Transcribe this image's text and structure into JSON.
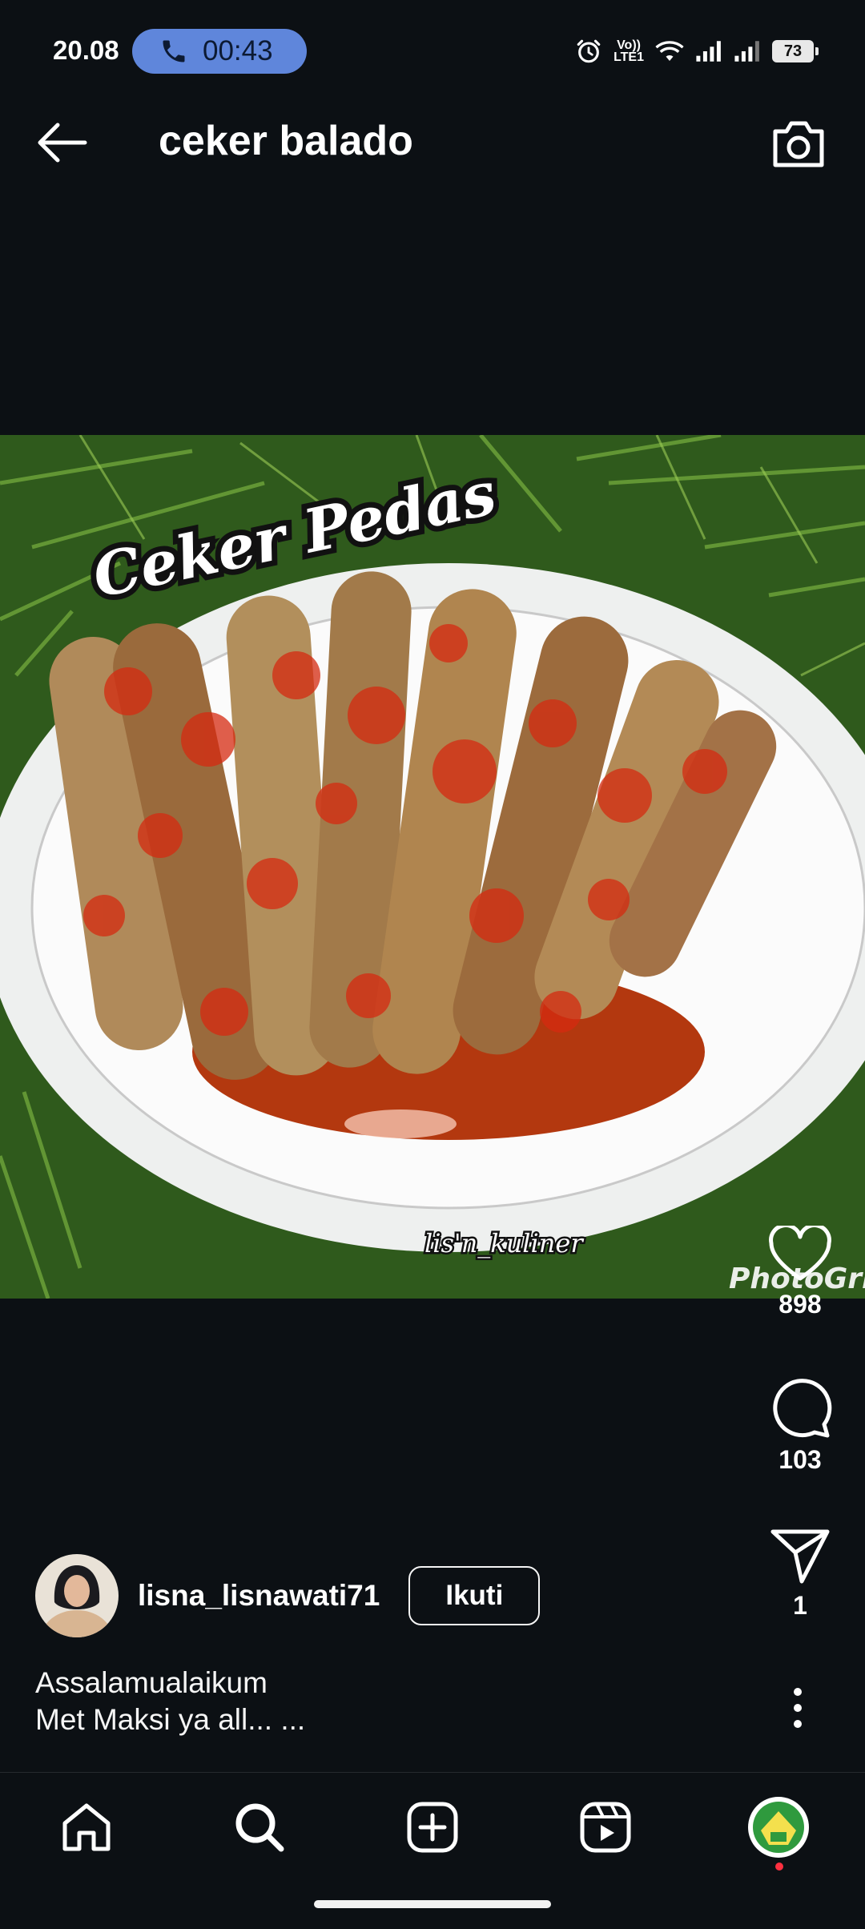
{
  "status_bar": {
    "time": "20.08",
    "call_timer": "00:43",
    "network_label_top": "Vo))",
    "network_label_bottom": "LTE1",
    "battery": "73"
  },
  "header": {
    "title": "ceker balado"
  },
  "post": {
    "image_overlay_title": "Ceker Pedas",
    "image_watermark": "lis'n_kuliner",
    "image_app_watermark": "PhotoGrid",
    "likes": "898",
    "comments": "103",
    "shares": "1",
    "author": {
      "username": "lisna_lisnawati71",
      "follow_label": "Ikuti"
    },
    "caption_line1": "Assalamualaikum",
    "caption_line2": "Met Maksi ya all... ..."
  },
  "bottom_nav": {
    "items": [
      "home-icon",
      "search-icon",
      "add-post-icon",
      "reels-icon",
      "profile-avatar"
    ]
  },
  "colors": {
    "background": "#0c1014",
    "call_pill": "#5f86db",
    "notification_dot": "#ff3040"
  }
}
